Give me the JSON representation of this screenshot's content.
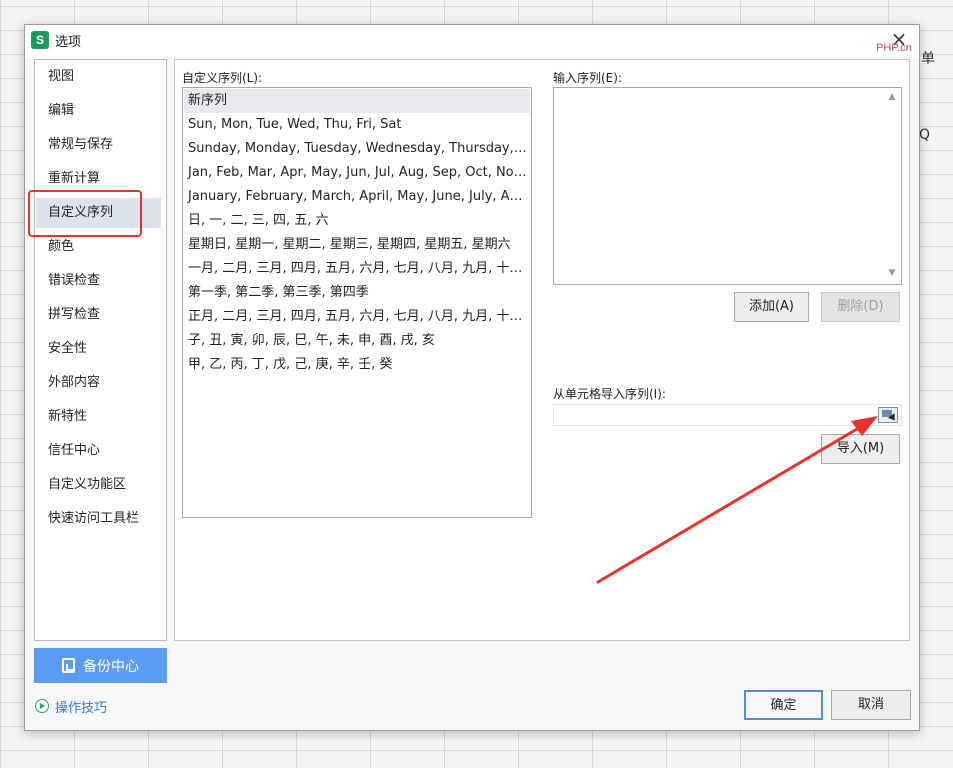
{
  "dialog": {
    "title": "选项",
    "app_icon_glyph": "S",
    "close_glyph": "×"
  },
  "watermark": "PHP.cn",
  "background": {
    "right_texts": [
      "单",
      "Q"
    ]
  },
  "sidebar": {
    "items": [
      {
        "label": "视图"
      },
      {
        "label": "编辑"
      },
      {
        "label": "常规与保存"
      },
      {
        "label": "重新计算"
      },
      {
        "label": "自定义序列",
        "active": true
      },
      {
        "label": "颜色"
      },
      {
        "label": "错误检查"
      },
      {
        "label": "拼写检查"
      },
      {
        "label": "安全性"
      },
      {
        "label": "外部内容"
      },
      {
        "label": "新特性"
      },
      {
        "label": "信任中心"
      },
      {
        "label": "自定义功能区"
      },
      {
        "label": "快速访问工具栏"
      }
    ],
    "backup_label": "备份中心",
    "tips_label": "操作技巧"
  },
  "custom_lists": {
    "label": "自定义序列(L):",
    "items": [
      "新序列",
      "Sun, Mon, Tue, Wed, Thu, Fri, Sat",
      "Sunday, Monday, Tuesday, Wednesday, Thursday, Frid...",
      "Jan, Feb, Mar, Apr, May, Jun, Jul, Aug, Sep, Oct, Nov, ...",
      "January, February, March, April, May, June, July, Augus...",
      "日, 一, 二, 三, 四, 五, 六",
      "星期日, 星期一, 星期二, 星期三, 星期四, 星期五, 星期六",
      "一月, 二月, 三月, 四月, 五月, 六月, 七月, 八月, 九月, 十月, ...",
      "第一季, 第二季, 第三季, 第四季",
      "正月, 二月, 三月, 四月, 五月, 六月, 七月, 八月, 九月, 十月, ...",
      "子, 丑, 寅, 卯, 辰, 巳, 午, 未, 申, 酉, 戌, 亥",
      "甲, 乙, 丙, 丁, 戊, 己, 庚, 辛, 壬, 癸"
    ],
    "selected_index": 0
  },
  "entries": {
    "label": "输入序列(E):",
    "value": "",
    "add_label": "添加(A)",
    "delete_label": "删除(D)"
  },
  "import": {
    "label": "从单元格导入序列(I):",
    "value": "",
    "import_label": "导入(M)"
  },
  "footer": {
    "ok_label": "确定",
    "cancel_label": "取消"
  },
  "colors": {
    "accent_blue": "#5b9bf2",
    "highlight_red": "#e8332a",
    "app_green": "#1c9a5d"
  }
}
